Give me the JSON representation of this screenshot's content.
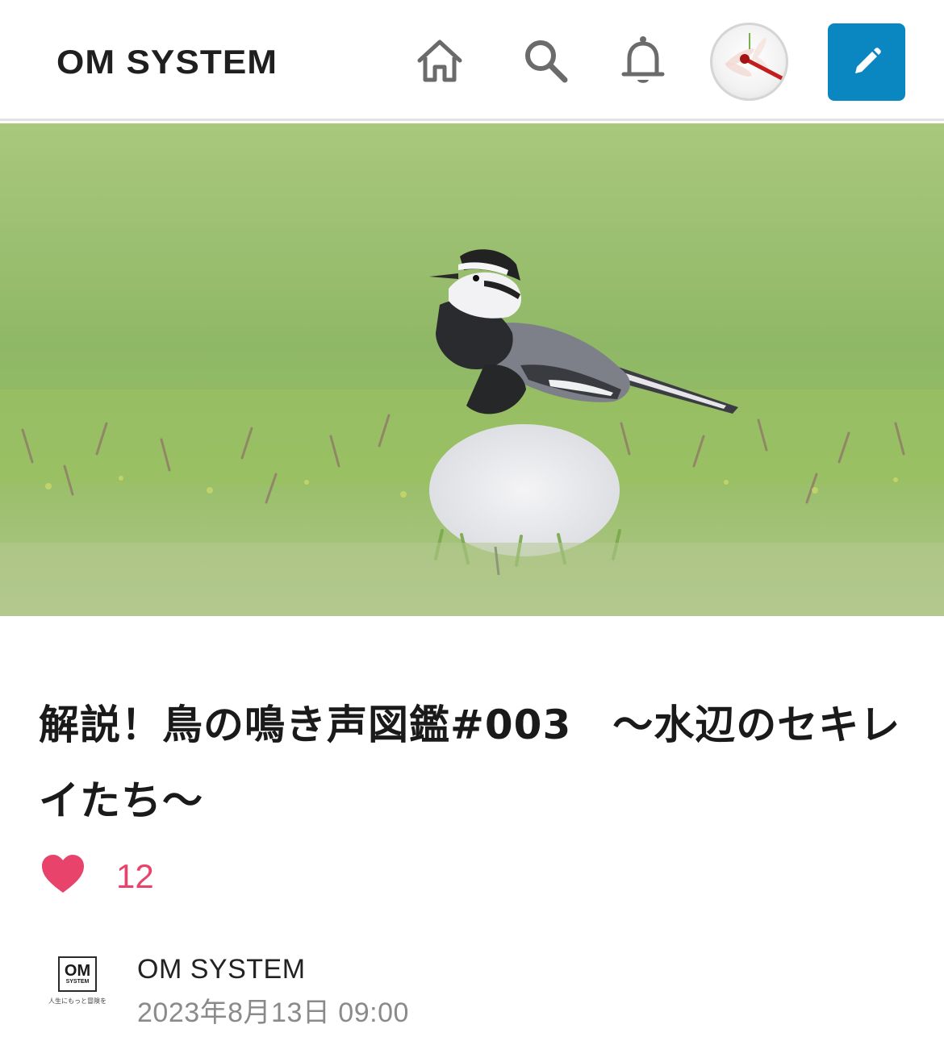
{
  "header": {
    "logo_text": "OM SYSTEM",
    "icons": [
      "home-icon",
      "search-icon",
      "bell-icon",
      "pencil-icon"
    ],
    "accent_color": "#0a87c0"
  },
  "hero": {
    "subject": "white wagtail bird standing on grass"
  },
  "article": {
    "title": "解説！鳥の鳴き声図鑑#003　～水辺のセキレイたち～",
    "like_count": "12",
    "like_color": "#e8436b"
  },
  "author": {
    "logo_top": "OM",
    "logo_bottom": "SYSTEM",
    "logo_tagline": "人生にもっと冒険を",
    "name": "OM SYSTEM",
    "date": "2023年8月13日 09:00"
  }
}
